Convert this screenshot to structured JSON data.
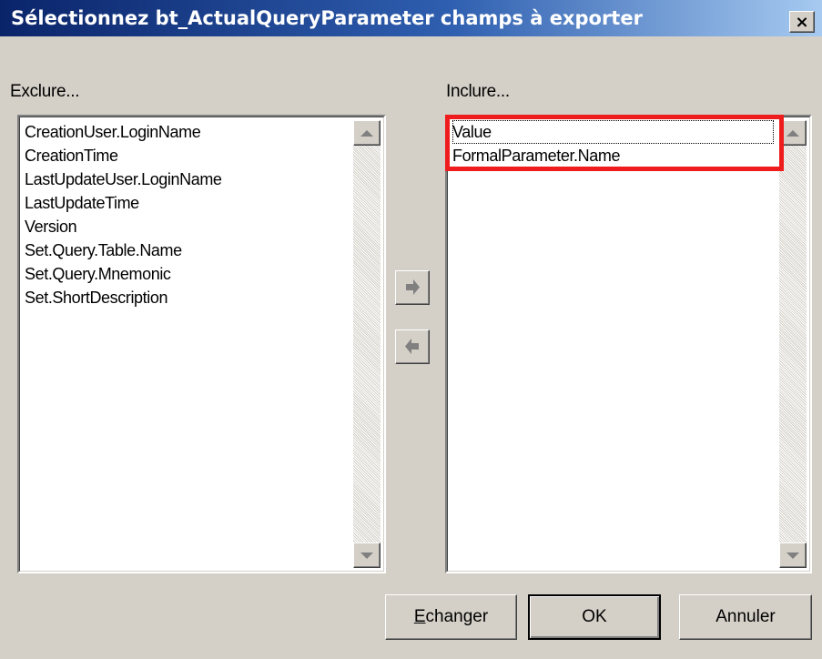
{
  "window": {
    "title": "Sélectionnez bt_ActualQueryParameter champs à exporter",
    "close_label": "×"
  },
  "exclude": {
    "label": "Exclure...",
    "items": [
      "CreationUser.LoginName",
      "CreationTime",
      "LastUpdateUser.LoginName",
      "LastUpdateTime",
      "Version",
      "Set.Query.Table.Name",
      "Set.Query.Mnemonic",
      "Set.ShortDescription"
    ]
  },
  "include": {
    "label": "Inclure...",
    "items": [
      "Value",
      "FormalParameter.Name"
    ]
  },
  "buttons": {
    "swap_mnemonic": "E",
    "swap_rest": "changer",
    "ok": "OK",
    "cancel": "Annuler"
  },
  "colors": {
    "highlight": "#ee1c1c",
    "arrow_gray": "#808080"
  },
  "icons": {
    "move_right": "arrow-right-icon",
    "move_left": "arrow-left-icon"
  }
}
